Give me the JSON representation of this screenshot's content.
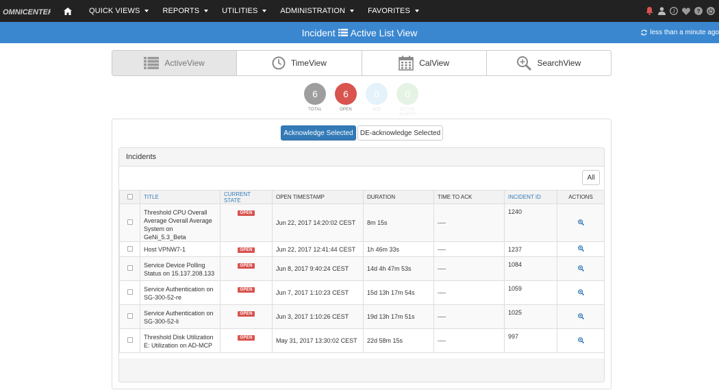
{
  "app": {
    "logo_text": "OMNICENTER"
  },
  "nav": {
    "items": [
      {
        "label": "QUICK VIEWS"
      },
      {
        "label": "REPORTS"
      },
      {
        "label": "UTILITIES"
      },
      {
        "label": "ADMINISTRATION"
      },
      {
        "label": "FAVORITES"
      }
    ],
    "icons": [
      "bell-icon",
      "user-icon",
      "user-badge-icon",
      "heart-icon",
      "help-icon",
      "power-icon"
    ],
    "colors": {
      "bar": "#222222",
      "bell": "#d9534f"
    }
  },
  "titlebar": {
    "before": "Incident",
    "after": "Active List View",
    "refresh_text": "less than a minute ago",
    "color": "#3a87d0"
  },
  "views": [
    {
      "label": "ActiveView",
      "icon": "list-icon",
      "active": true
    },
    {
      "label": "TimeView",
      "icon": "clock-icon",
      "active": false
    },
    {
      "label": "CalView",
      "icon": "calendar-icon",
      "active": false
    },
    {
      "label": "SearchView",
      "icon": "search-icon",
      "active": false
    }
  ],
  "stats": [
    {
      "value": "6",
      "label": "TOTAL",
      "color": "#9e9e9e"
    },
    {
      "value": "6",
      "label": "OPEN",
      "color": "#d9534f"
    },
    {
      "value": "0",
      "label": "ACK",
      "color": "#e3f2fb"
    },
    {
      "value": "0",
      "label": "ACTIVE ALERTS",
      "color": "#e5f3e5"
    }
  ],
  "actions": {
    "ack": "Acknowledge Selected",
    "deack": "DE-acknowledge Selected"
  },
  "incidents": {
    "heading": "Incidents",
    "all_button": "All",
    "columns": {
      "title": "TITLE",
      "state": "CURRENT STATE",
      "opened": "OPEN TIMESTAMP",
      "duration": "DURATION",
      "ack": "TIME TO ACK",
      "id": "INCIDENT ID",
      "actions": "ACTIONS"
    },
    "rows": [
      {
        "title": "Threshold CPU Overall Average Overall Average System on GeNi_5.3_Beta",
        "state": "OPEN",
        "opened": "Jun 22, 2017 14:20:02 CEST",
        "duration": "8m 15s",
        "ack": "----",
        "id": "1240"
      },
      {
        "title": "Host VPNW7-1",
        "state": "OPEN",
        "opened": "Jun 22, 2017 12:41:44 CEST",
        "duration": "1h 46m 33s",
        "ack": "----",
        "id": "1237"
      },
      {
        "title": "Service Device Polling Status on 15.137.208.133",
        "state": "OPEN",
        "opened": "Jun 8, 2017 9:40:24 CEST",
        "duration": "14d 4h 47m 53s",
        "ack": "----",
        "id": "1084"
      },
      {
        "title": "Service Authentication on SG-300-52-re",
        "state": "OPEN",
        "opened": "Jun 7, 2017 1:10:23 CEST",
        "duration": "15d 13h 17m 54s",
        "ack": "----",
        "id": "1059"
      },
      {
        "title": "Service Authentication on SG-300-52-li",
        "state": "OPEN",
        "opened": "Jun 3, 2017 1:10:26 CEST",
        "duration": "19d 13h 17m 51s",
        "ack": "----",
        "id": "1025"
      },
      {
        "title": "Threshold Disk Utilization E: Utilization on AD-MCP",
        "state": "OPEN",
        "opened": "May 31, 2017 13:30:02 CEST",
        "duration": "22d 58m 15s",
        "ack": "----",
        "id": "997"
      }
    ]
  }
}
